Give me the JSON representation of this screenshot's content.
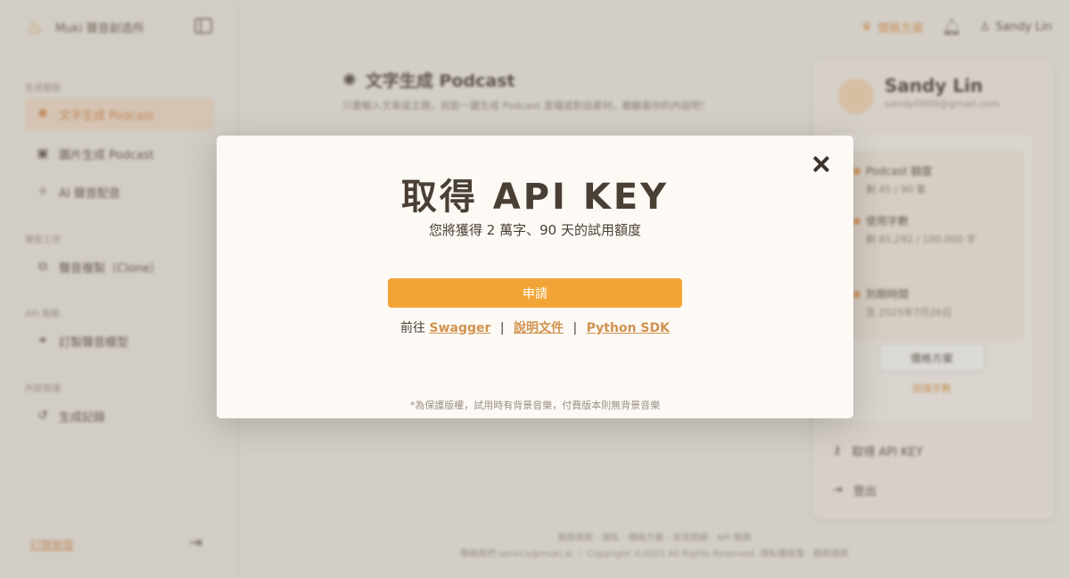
{
  "background": {
    "sidebar": {
      "brand_name": "Muki 聲音創造所",
      "sections": [
        {
          "label": "生成服務",
          "items": [
            {
              "label": "文字生成 Podcast",
              "icon": "sparkle-icon",
              "active": true
            },
            {
              "label": "圖片生成 Podcast",
              "icon": "image-icon",
              "active": false
            },
            {
              "label": "AI 聲音配音",
              "icon": "wand-icon",
              "active": false
            }
          ]
        },
        {
          "label": "聲音工坊",
          "items": [
            {
              "label": "聲音複製（Clone）",
              "icon": "copy-icon",
              "active": false
            }
          ]
        },
        {
          "label": "API 服務",
          "items": [
            {
              "label": "訂製聲音模型",
              "icon": "link-icon",
              "active": false
            }
          ]
        },
        {
          "label": "內容管理",
          "items": [
            {
              "label": "生成記錄",
              "icon": "history-icon",
              "active": false
            }
          ]
        }
      ],
      "bottom_link": "訂閱管理"
    },
    "topbar": {
      "plan_label": "價格方案",
      "user_name": "Sandy Lin"
    },
    "main": {
      "title": "文字生成 Podcast",
      "subtitle": "只要輸入文章或主題，就能一鍵生成 Podcast 音檔或對話素材，聽聽看你的內容吧！"
    },
    "right_panel": {
      "name": "Sandy Lin",
      "email": "sandy0000@gmail.com",
      "stats": [
        {
          "label": "Podcast 額度",
          "value": "剩 45 / 90 集"
        },
        {
          "label": "使用字數",
          "value": "剩 85,292 / 100,000 字"
        },
        {
          "label": "到期時間",
          "value": "至 2025年7月26日"
        }
      ],
      "upgrade_button": "價格方案",
      "upgrade_link": "加值字數",
      "actions": [
        {
          "label": "取得 API KEY",
          "icon": "key-icon"
        },
        {
          "label": "登出",
          "icon": "logout-icon"
        }
      ]
    },
    "footer": {
      "line1": "服務條款 · 隱私 · 價格方案 · 常見問題 · API 服務",
      "line2": "聯絡我們 service@muki.ai ｜ Copyright ©2025 All Rights Reserved. 隱私權政策 · 服務條款"
    }
  },
  "modal": {
    "title": "取得 API KEY",
    "subtitle": "您將獲得 2 萬字、90 天的試用額度",
    "apply_button": "申請",
    "links_prefix": "前往",
    "links": [
      "Swagger",
      "說明文件",
      "Python SDK"
    ],
    "separator": "|",
    "note": "*為保護版權，試用時有背景音樂，付費版本則無背景音樂"
  },
  "colors": {
    "accent": "#f2a536",
    "link": "#d09350",
    "text": "#4a3f35"
  }
}
